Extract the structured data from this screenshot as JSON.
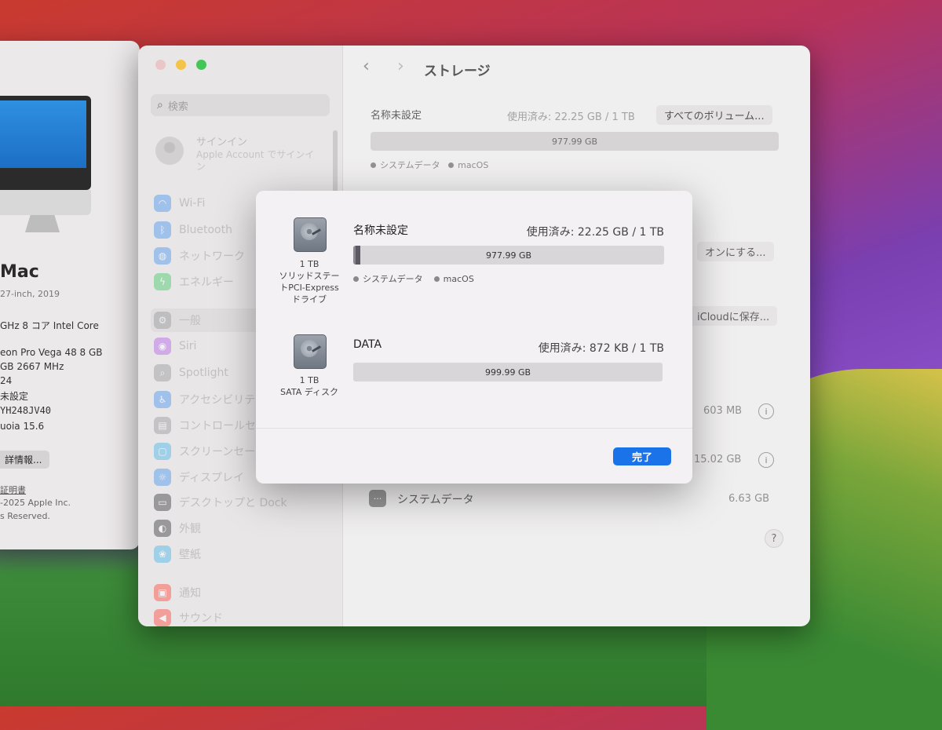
{
  "about": {
    "title": "Mac",
    "subtitle": "27-inch, 2019",
    "lines": [
      "GHz 8 コア Intel Core",
      "eon Pro Vega 48 8 GB",
      "GB 2667 MHz",
      "24",
      "未設定",
      "YH248JV40",
      "uoia 15.6"
    ],
    "more_info_button": "詳情報...",
    "license_link": "証明書",
    "copyright_1": "-2025 Apple Inc.",
    "copyright_2": "s Reserved."
  },
  "settings": {
    "search_placeholder": "検索",
    "signin_title": "サインイン",
    "signin_sub": "Apple Account でサインイン",
    "sidebar_items": [
      {
        "label": "Wi-Fi",
        "color": "#3a8ef0",
        "glyph": "◠"
      },
      {
        "label": "Bluetooth",
        "color": "#3a8ef0",
        "glyph": "ᛒ"
      },
      {
        "label": "ネットワーク",
        "color": "#3a8ef0",
        "glyph": "◍"
      },
      {
        "label": "エネルギー",
        "color": "#34c759",
        "glyph": "ϟ"
      },
      {
        "label": "一般",
        "color": "#8e8e93",
        "glyph": "⚙"
      },
      {
        "label": "Siri",
        "color": "#b058e8",
        "glyph": "◉"
      },
      {
        "label": "Spotlight",
        "color": "#8e8e93",
        "glyph": "⌕"
      },
      {
        "label": "アクセシビリテ",
        "color": "#3a8ef0",
        "glyph": "♿"
      },
      {
        "label": "コントロールセ",
        "color": "#8e8e93",
        "glyph": "▤"
      },
      {
        "label": "スクリーンセー",
        "color": "#3ab0e8",
        "glyph": "▢"
      },
      {
        "label": "ディスプレイ",
        "color": "#3a8ef0",
        "glyph": "☼"
      },
      {
        "label": "デスクトップと Dock",
        "color": "#2c2c2e",
        "glyph": "▭"
      },
      {
        "label": "外観",
        "color": "#2c2c2e",
        "glyph": "◐"
      },
      {
        "label": "壁紙",
        "color": "#3ab0e8",
        "glyph": "❀"
      },
      {
        "label": "通知",
        "color": "#ff3b30",
        "glyph": "▣"
      },
      {
        "label": "サウンド",
        "color": "#ff3b30",
        "glyph": "◀"
      }
    ],
    "page_title": "ストレージ",
    "volume_name": "名称未設定",
    "volume_used": "使用済み: 22.25 GB / 1 TB",
    "all_volumes_button": "すべてのボリューム...",
    "volume_bar_label": "977.99 GB",
    "legend_system": "システムデータ",
    "legend_macos": "macOS",
    "turn_on_button": "オンにする...",
    "icloud_button": "iCloudに保存...",
    "size_1": "603 MB",
    "size_2": "15.02 GB",
    "system_data_label": "システムデータ",
    "system_data_size": "6.63 GB",
    "help": "?"
  },
  "modal": {
    "disks": [
      {
        "caption_lines": [
          "1 TB",
          "ソリッドステー",
          "トPCI-Express",
          "ドライブ"
        ],
        "name": "名称未設定",
        "used": "使用済み: 22.25 GB / 1 TB",
        "bar_label": "977.99 GB",
        "used_fraction": 0.022,
        "legend_system": "システムデータ",
        "legend_macos": "macOS"
      },
      {
        "caption_lines": [
          "1 TB",
          "SATA ディスク"
        ],
        "name": "DATA",
        "used": "使用済み: 872 KB / 1 TB",
        "bar_label": "999.99 GB",
        "used_fraction": 0.0
      }
    ],
    "done_button": "完了"
  }
}
